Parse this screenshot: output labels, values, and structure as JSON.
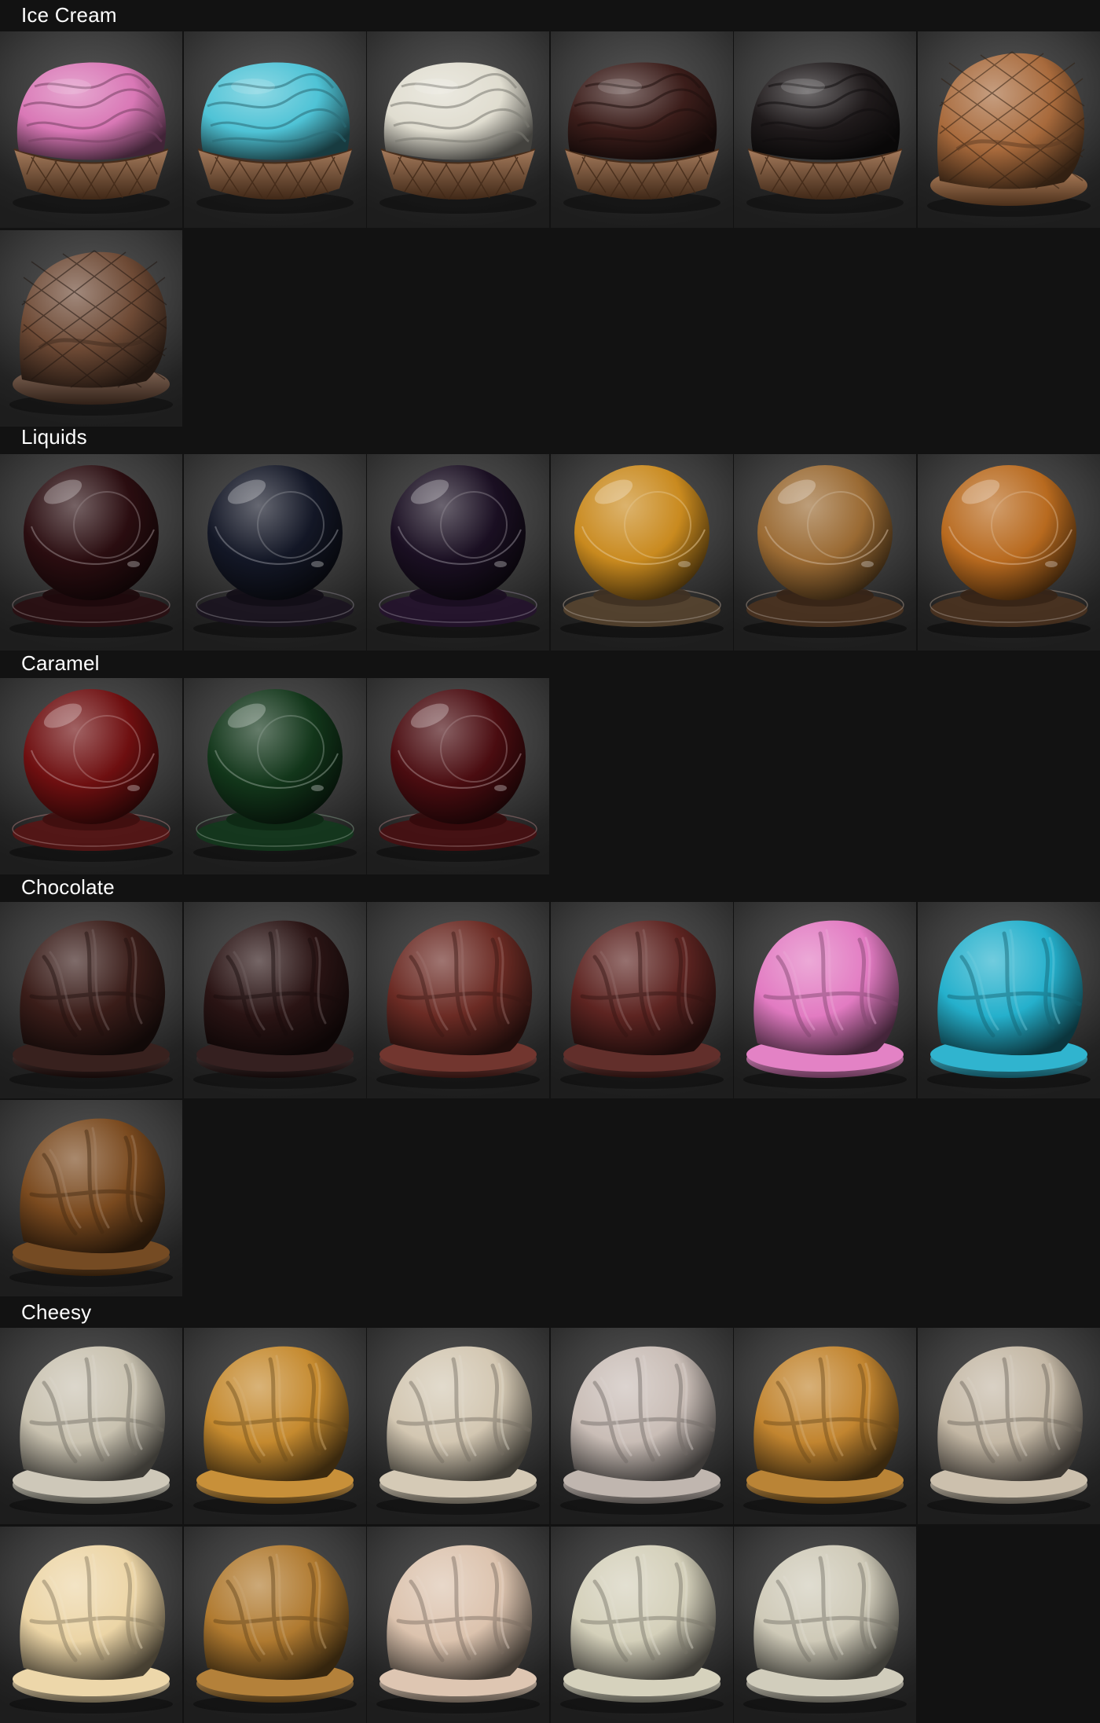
{
  "background_color": "#121212",
  "sections": [
    {
      "title": "Ice Cream",
      "swatches": [
        {
          "shape": "ice-cream-cup",
          "color": "#d978b6",
          "base": "#8f5a33"
        },
        {
          "shape": "ice-cream-cup",
          "color": "#4fc3d6",
          "base": "#8f5a33"
        },
        {
          "shape": "ice-cream-cup",
          "color": "#e0ddd0",
          "base": "#8f5a33"
        },
        {
          "shape": "ice-cream-cup",
          "color": "#3b1d1a",
          "base": "#8f5a33"
        },
        {
          "shape": "ice-cream-cup",
          "color": "#1f1a1b",
          "base": "#8f5a33"
        },
        {
          "shape": "wafer-drape",
          "color": "#a86a3c",
          "base": "#a86a3c"
        },
        {
          "shape": "wafer-drape",
          "color": "#6e4a35",
          "base": "#6e4a35"
        }
      ]
    },
    {
      "title": "Liquids",
      "swatches": [
        {
          "shape": "glass-sphere",
          "color": "#2a0d10",
          "base": "#2a0d10"
        },
        {
          "shape": "glass-sphere",
          "color": "#131726",
          "base": "#1a1320"
        },
        {
          "shape": "glass-sphere",
          "color": "#1a0f22",
          "base": "#24122e"
        },
        {
          "shape": "glass-sphere",
          "color": "#c98a1f",
          "base": "#5a4630"
        },
        {
          "shape": "glass-sphere",
          "color": "#9a6a33",
          "base": "#4d3420"
        },
        {
          "shape": "glass-sphere",
          "color": "#b86a1f",
          "base": "#4d3420"
        }
      ]
    },
    {
      "title": "Caramel",
      "swatches": [
        {
          "shape": "glass-sphere",
          "color": "#6e0f10",
          "base": "#5a1414"
        },
        {
          "shape": "glass-sphere",
          "color": "#12361a",
          "base": "#123a1c"
        },
        {
          "shape": "glass-sphere",
          "color": "#4a0c10",
          "base": "#4a0e10"
        }
      ]
    },
    {
      "title": "Chocolate",
      "swatches": [
        {
          "shape": "drape",
          "color": "#3a1d19",
          "base": "#2e1512"
        },
        {
          "shape": "drape",
          "color": "#2a1414",
          "base": "#2a1414"
        },
        {
          "shape": "drape",
          "color": "#6b2b24",
          "base": "#6b2b24"
        },
        {
          "shape": "drape",
          "color": "#5d2421",
          "base": "#5a2420"
        },
        {
          "shape": "drape",
          "color": "#e27bc2",
          "base": "#e27bc2"
        },
        {
          "shape": "drape",
          "color": "#25b0cc",
          "base": "#25b0cc"
        },
        {
          "shape": "drape",
          "color": "#7a4a1f",
          "base": "#6e4117"
        }
      ]
    },
    {
      "title": "Cheesy",
      "swatches": [
        {
          "shape": "drape",
          "color": "#c9c2b0",
          "base": "#cbc5b5"
        },
        {
          "shape": "drape",
          "color": "#c58a2f",
          "base": "#c58a2f"
        },
        {
          "shape": "drape",
          "color": "#d3c7b2",
          "base": "#d3c7b2"
        },
        {
          "shape": "drape",
          "color": "#c9bdb6",
          "base": "#bdb2ab"
        },
        {
          "shape": "drape",
          "color": "#c28530",
          "base": "#b67d2b"
        },
        {
          "shape": "drape",
          "color": "#c4b8a5",
          "base": "#c9bda9"
        },
        {
          "shape": "drape",
          "color": "#ecd5a6",
          "base": "#ecd5a6"
        },
        {
          "shape": "drape",
          "color": "#b07a30",
          "base": "#b07a30"
        },
        {
          "shape": "drape",
          "color": "#dcc3ae",
          "base": "#dcc3ae"
        },
        {
          "shape": "drape",
          "color": "#d4d0ba",
          "base": "#d4d0ba"
        },
        {
          "shape": "drape",
          "color": "#cfcab8",
          "base": "#cfcab8"
        }
      ]
    }
  ]
}
